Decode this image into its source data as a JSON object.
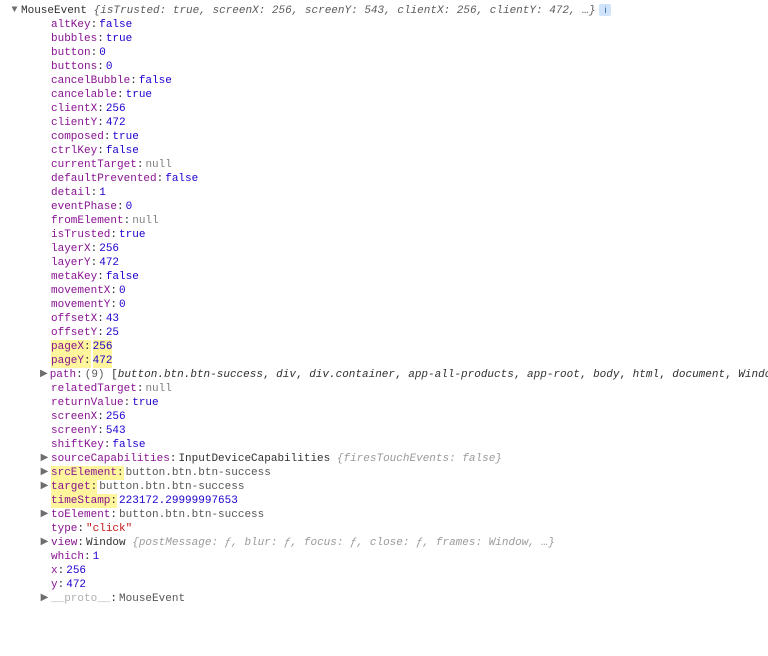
{
  "header": {
    "className": "MouseEvent",
    "summaryPairs": [
      {
        "k": "isTrusted",
        "v": "true"
      },
      {
        "k": "screenX",
        "v": "256"
      },
      {
        "k": "screenY",
        "v": "543"
      },
      {
        "k": "clientX",
        "v": "256"
      },
      {
        "k": "clientY",
        "v": "472"
      }
    ],
    "ellipsis": "…"
  },
  "lines": [
    {
      "type": "kv",
      "key": "altKey",
      "valType": "bool",
      "val": "false"
    },
    {
      "type": "kv",
      "key": "bubbles",
      "valType": "bool",
      "val": "true"
    },
    {
      "type": "kv",
      "key": "button",
      "valType": "num",
      "val": "0"
    },
    {
      "type": "kv",
      "key": "buttons",
      "valType": "num",
      "val": "0"
    },
    {
      "type": "kv",
      "key": "cancelBubble",
      "valType": "bool",
      "val": "false"
    },
    {
      "type": "kv",
      "key": "cancelable",
      "valType": "bool",
      "val": "true"
    },
    {
      "type": "kv",
      "key": "clientX",
      "valType": "num",
      "val": "256"
    },
    {
      "type": "kv",
      "key": "clientY",
      "valType": "num",
      "val": "472"
    },
    {
      "type": "kv",
      "key": "composed",
      "valType": "bool",
      "val": "true"
    },
    {
      "type": "kv",
      "key": "ctrlKey",
      "valType": "bool",
      "val": "false"
    },
    {
      "type": "kv",
      "key": "currentTarget",
      "valType": "null",
      "val": "null"
    },
    {
      "type": "kv",
      "key": "defaultPrevented",
      "valType": "bool",
      "val": "false"
    },
    {
      "type": "kv",
      "key": "detail",
      "valType": "num",
      "val": "1"
    },
    {
      "type": "kv",
      "key": "eventPhase",
      "valType": "num",
      "val": "0"
    },
    {
      "type": "kv",
      "key": "fromElement",
      "valType": "null",
      "val": "null"
    },
    {
      "type": "kv",
      "key": "isTrusted",
      "valType": "bool",
      "val": "true"
    },
    {
      "type": "kv",
      "key": "layerX",
      "valType": "num",
      "val": "256"
    },
    {
      "type": "kv",
      "key": "layerY",
      "valType": "num",
      "val": "472"
    },
    {
      "type": "kv",
      "key": "metaKey",
      "valType": "bool",
      "val": "false"
    },
    {
      "type": "kv",
      "key": "movementX",
      "valType": "num",
      "val": "0"
    },
    {
      "type": "kv",
      "key": "movementY",
      "valType": "num",
      "val": "0"
    },
    {
      "type": "kv",
      "key": "offsetX",
      "valType": "num",
      "val": "43"
    },
    {
      "type": "kv",
      "key": "offsetY",
      "valType": "num",
      "val": "25"
    },
    {
      "type": "kv",
      "key": "pageX",
      "valType": "num",
      "val": "256",
      "hlKey": true,
      "hlVal": true
    },
    {
      "type": "kv",
      "key": "pageY",
      "valType": "num",
      "val": "472",
      "hlKey": true,
      "hlVal": true
    },
    {
      "type": "path",
      "key": "path",
      "count": "9",
      "items": [
        "button.btn.btn-success",
        "div",
        "div.container",
        "app-all-products",
        "app-root",
        "body",
        "html",
        "document",
        "Window"
      ]
    },
    {
      "type": "kv",
      "key": "relatedTarget",
      "valType": "null",
      "val": "null"
    },
    {
      "type": "kv",
      "key": "returnValue",
      "valType": "bool",
      "val": "true"
    },
    {
      "type": "kv",
      "key": "screenX",
      "valType": "num",
      "val": "256"
    },
    {
      "type": "kv",
      "key": "screenY",
      "valType": "num",
      "val": "543"
    },
    {
      "type": "kv",
      "key": "shiftKey",
      "valType": "bool",
      "val": "false"
    },
    {
      "type": "expand",
      "key": "sourceCapabilities",
      "previewClass": "InputDeviceCapabilities",
      "previewInner": "firesTouchEvents: false"
    },
    {
      "type": "ref",
      "key": "srcElement",
      "val": "button.btn.btn-success",
      "expandable": true,
      "hlKey": true
    },
    {
      "type": "ref",
      "key": "target",
      "val": "button.btn.btn-success",
      "expandable": true,
      "hlKey": true
    },
    {
      "type": "kv",
      "key": "timeStamp",
      "valType": "num",
      "val": "223172.29999997653",
      "hlKey": true
    },
    {
      "type": "ref",
      "key": "toElement",
      "val": "button.btn.btn-success",
      "expandable": true
    },
    {
      "type": "kv",
      "key": "type",
      "valType": "str",
      "val": "\"click\""
    },
    {
      "type": "expand",
      "key": "view",
      "previewClass": "Window",
      "previewInner": "postMessage: ƒ, blur: ƒ, focus: ƒ, close: ƒ, frames: Window, …"
    },
    {
      "type": "kv",
      "key": "which",
      "valType": "num",
      "val": "1"
    },
    {
      "type": "kv",
      "key": "x",
      "valType": "num",
      "val": "256"
    },
    {
      "type": "kv",
      "key": "y",
      "valType": "num",
      "val": "472"
    },
    {
      "type": "proto",
      "key": "__proto__",
      "val": "MouseEvent"
    }
  ]
}
